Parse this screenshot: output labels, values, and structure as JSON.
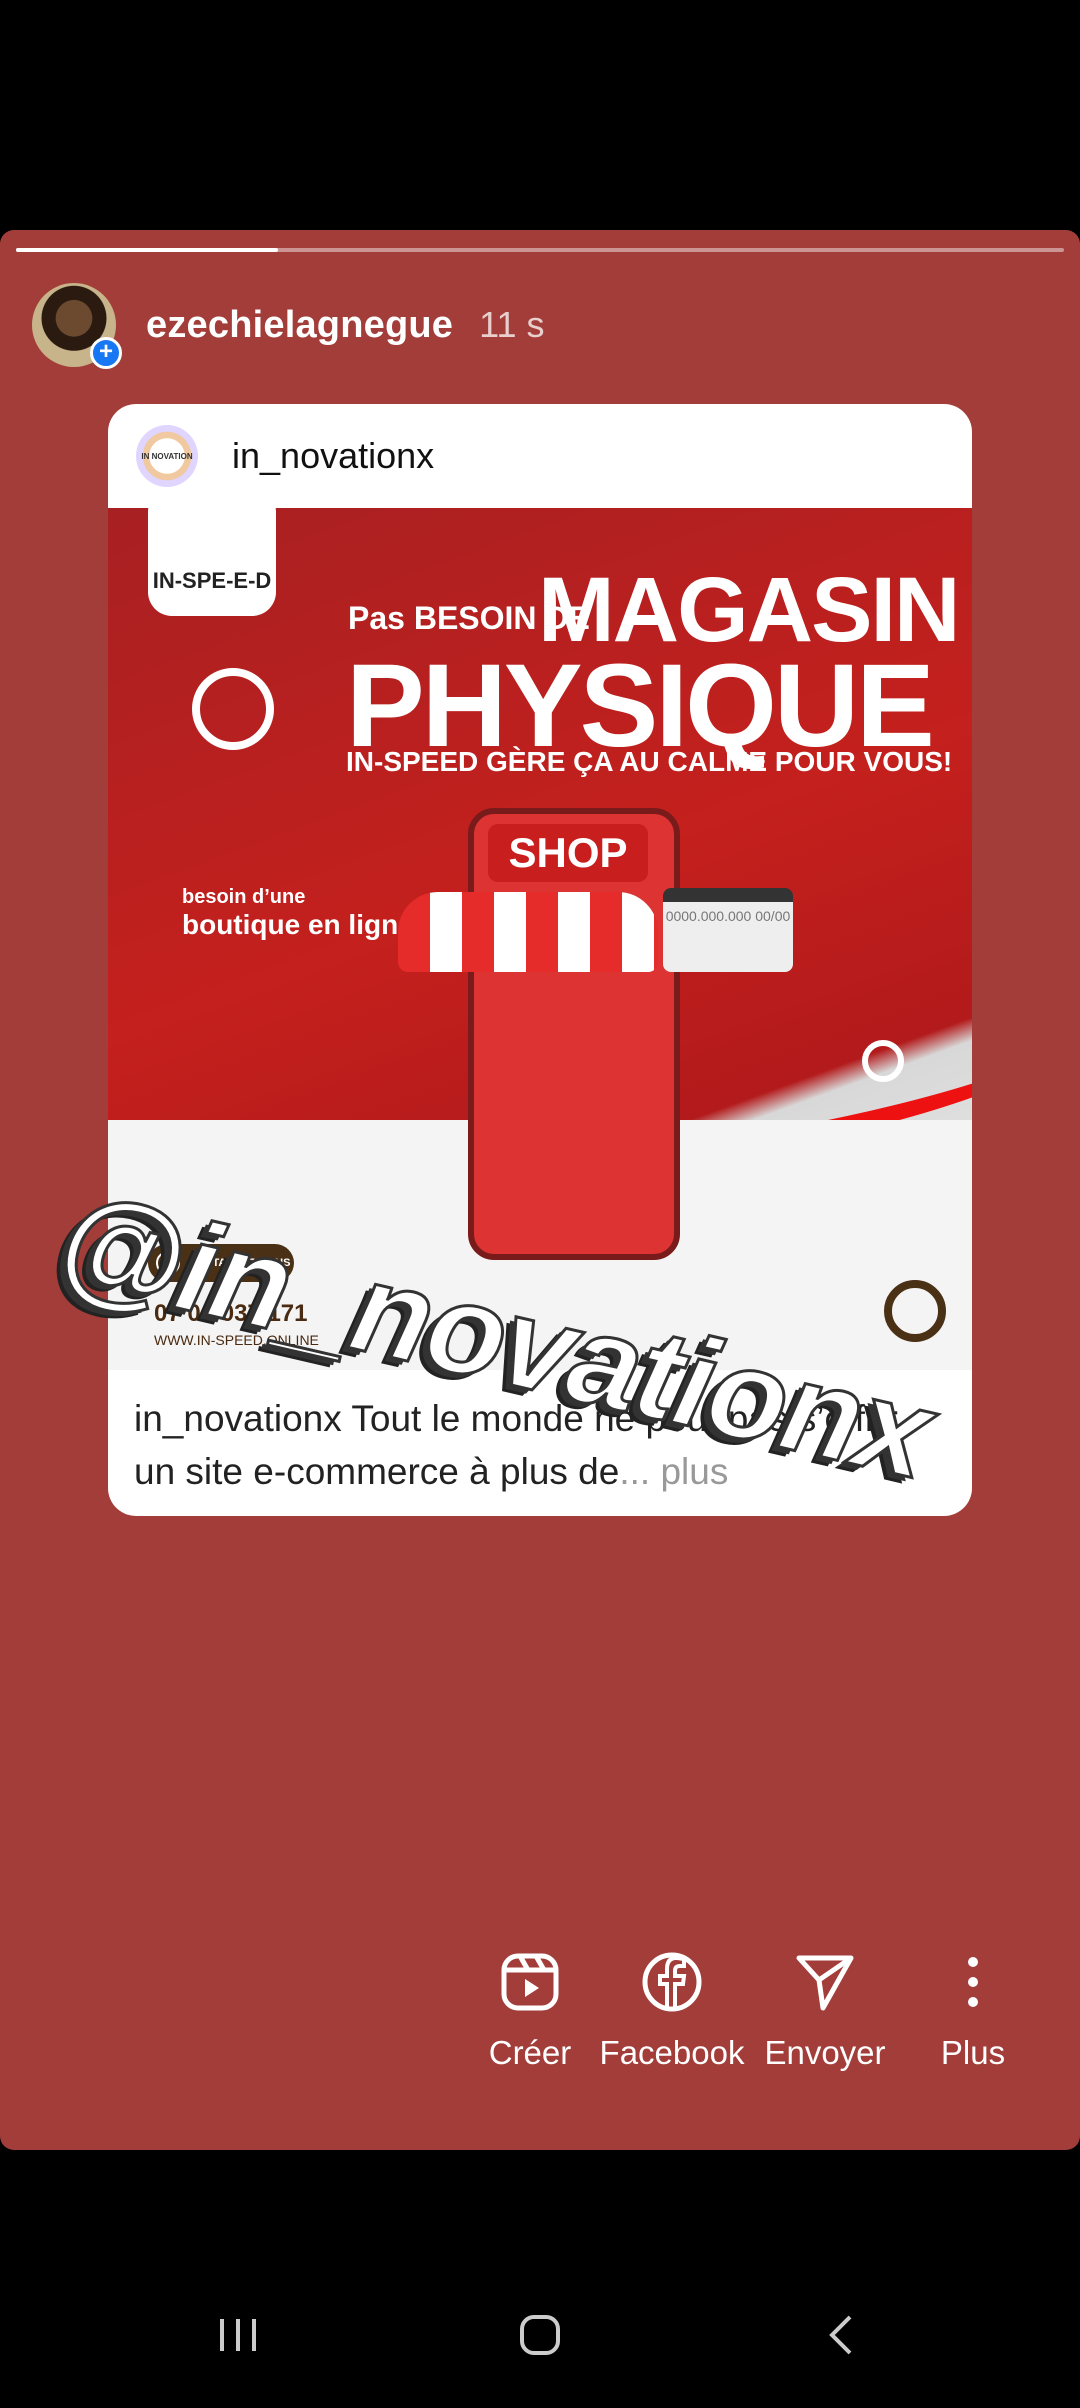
{
  "story": {
    "username": "ezechielagnegue",
    "time": "11 s",
    "progress": 0.25
  },
  "card": {
    "username": "in_novationx",
    "avatar_text": "IN NOVATION",
    "caption_text": "in_novationx Tout le monde ne peut pas s’offrir un site e-commerce à plus de",
    "caption_ellipsis": "...",
    "caption_more": "plus"
  },
  "post_image": {
    "brand": "IN-SPE-E-D",
    "headline_small": "Pas BESOIN DE",
    "headline_big": "MAGASIN",
    "headline_phys": "PHYSIQUE",
    "headline_sub": "IN-SPEED GÈRE ÇA AU CALME POUR VOUS!",
    "boutique_line1": "besoin d’une",
    "boutique_line2": "boutique en ligne ?",
    "shop": "SHOP",
    "card_number": "0000.000.000 00/00",
    "contact": "CONTACTEZ-NOUS",
    "phone": "07 04 037 171",
    "website": "WWW.IN-SPEED.ONLINE"
  },
  "sticker": {
    "mention": "@in_novationx"
  },
  "actions": [
    {
      "label": "Créer",
      "icon": "reels-icon"
    },
    {
      "label": "Facebook",
      "icon": "facebook-icon"
    },
    {
      "label": "Envoyer",
      "icon": "send-icon"
    },
    {
      "label": "Plus",
      "icon": "more-vertical-icon"
    }
  ],
  "navbar": {
    "recents": "recents-icon",
    "home": "home-icon",
    "back": "back-icon"
  },
  "colors": {
    "story_bg": "#a23d39",
    "post_red": "#c4201d",
    "facebook_blue": "#1877f2"
  }
}
